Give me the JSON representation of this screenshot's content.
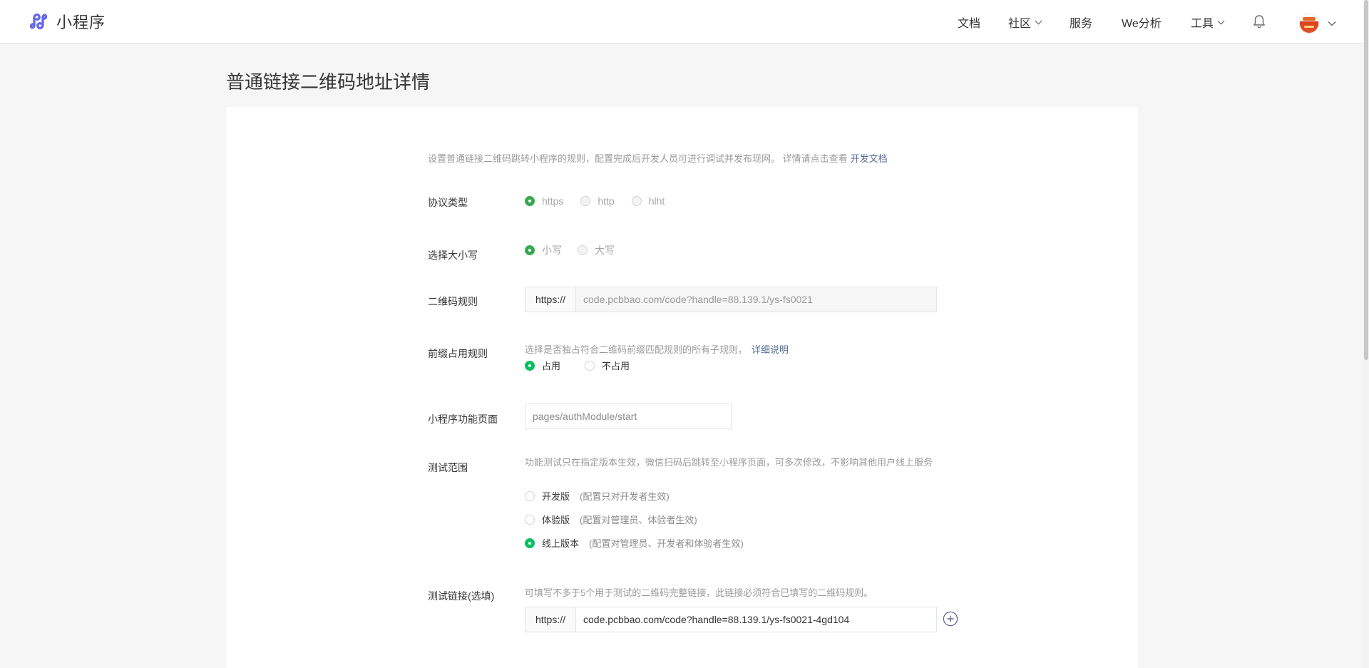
{
  "app": {
    "name": "小程序"
  },
  "nav": {
    "items": [
      {
        "label": "文档",
        "has_dropdown": false
      },
      {
        "label": "社区",
        "has_dropdown": true
      },
      {
        "label": "服务",
        "has_dropdown": false
      },
      {
        "label": "We分析",
        "has_dropdown": false
      },
      {
        "label": "工具",
        "has_dropdown": true
      }
    ],
    "icons": [
      "bell-icon",
      "avatar",
      "chevron-down-icon"
    ]
  },
  "page": {
    "title": "普通链接二维码地址详情"
  },
  "intro": {
    "text": "设置普通链接二维码跳转小程序的规则，配置完成后开发人员可进行调试并发布现网。 详情请点击查看",
    "link": "开发文档"
  },
  "protocol": {
    "label": "协议类型",
    "options": [
      "https",
      "http",
      "hlht"
    ],
    "selected": "https"
  },
  "case": {
    "label": "选择大小写",
    "options": [
      "小写",
      "大写"
    ],
    "selected": "小写"
  },
  "qr_rule": {
    "label": "二维码规则",
    "prefix": "https://",
    "value": "code.pcbbao.com/code?handle=88.139.1/ys-fs0021"
  },
  "prefix_rule": {
    "label": "前缀占用规则",
    "hint": "选择是否独占符合二维码前缀匹配规则的所有子规则，",
    "hint_link": "详细说明",
    "options": [
      "占用",
      "不占用"
    ],
    "selected": "占用"
  },
  "function_page": {
    "label": "小程序功能页面",
    "value": "pages/authModule/start"
  },
  "test_scope": {
    "label": "测试范围",
    "hint": "功能测试只在指定版本生效，微信扫码后跳转至小程序页面，可多次修改，不影响其他用户线上服务",
    "options": [
      {
        "name": "开发版",
        "desc": "(配置只对开发者生效)"
      },
      {
        "name": "体验版",
        "desc": "(配置对管理员、体验者生效)"
      },
      {
        "name": "线上版本",
        "desc": "(配置对管理员、开发者和体验者生效)"
      }
    ],
    "selected": "线上版本"
  },
  "test_link": {
    "label": "测试链接(选填)",
    "hint": "可填写不多于5个用于测试的二维码完整链接，此链接必须符合已填写的二维码规则。",
    "prefix": "https://",
    "value": "code.pcbbao.com/code?handle=88.139.1/ys-fs0021-4gd104"
  },
  "colors": {
    "accent_green": "#07c160",
    "link_blue": "#576b95",
    "text_primary": "#353535",
    "text_secondary": "#9a9a9a",
    "background": "#f6f6f6"
  }
}
